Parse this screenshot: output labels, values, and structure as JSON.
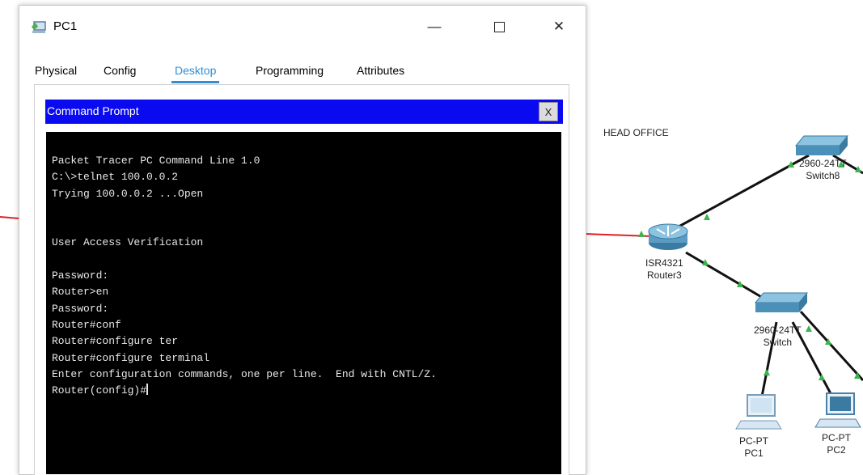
{
  "window": {
    "title": "PC1",
    "controls": {
      "minimize_icon": "minimize-icon",
      "maximize_icon": "maximize-icon",
      "close_icon": "close-icon"
    }
  },
  "tabs": [
    {
      "label": "Physical",
      "active": false
    },
    {
      "label": "Config",
      "active": false
    },
    {
      "label": "Desktop",
      "active": true
    },
    {
      "label": "Programming",
      "active": false
    },
    {
      "label": "Attributes",
      "active": false
    }
  ],
  "command_prompt": {
    "title": "Command Prompt",
    "close_label": "X",
    "lines": [
      "Packet Tracer PC Command Line 1.0",
      "C:\\>telnet 100.0.0.2",
      "Trying 100.0.0.2 ...Open",
      "",
      "",
      "User Access Verification",
      "",
      "Password:",
      "Router>en",
      "Password:",
      "Router#conf",
      "Router#configure ter",
      "Router#configure terminal",
      "Enter configuration commands, one per line.  End with CNTL/Z.",
      "Router(config)#"
    ]
  },
  "topology": {
    "area_label": "HEAD OFFICE",
    "devices": [
      {
        "model": "ISR4321",
        "name": "Router3",
        "icon": "router-icon"
      },
      {
        "model": "2960-24TT",
        "name": "Switch8",
        "icon": "switch-icon"
      },
      {
        "model": "2960-24TT",
        "name": "Switch",
        "icon": "switch-icon"
      },
      {
        "model": "PC-PT",
        "name": "PC1",
        "icon": "pc-icon"
      },
      {
        "model": "PC-PT",
        "name": "PC2",
        "icon": "pc-icon"
      }
    ],
    "colors": {
      "link": "#111111",
      "serial_link": "#e0202a",
      "link_up": "#39b54a",
      "device_blue": "#4a90b8"
    }
  }
}
